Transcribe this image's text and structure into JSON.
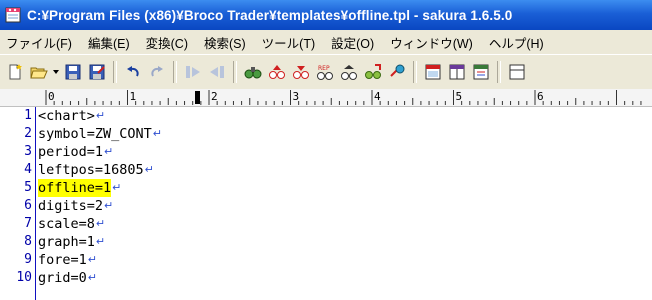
{
  "window": {
    "title": "C:¥Program Files (x86)¥Broco Trader¥templates¥offline.tpl - sakura 1.6.5.0",
    "icon": "sakura-notepad-icon"
  },
  "menu": [
    {
      "label": "ファイル(F)"
    },
    {
      "label": "編集(E)"
    },
    {
      "label": "変換(C)"
    },
    {
      "label": "検索(S)"
    },
    {
      "label": "ツール(T)"
    },
    {
      "label": "設定(O)"
    },
    {
      "label": "ウィンドウ(W)"
    },
    {
      "label": "ヘルプ(H)"
    }
  ],
  "ruler": {
    "labels": [
      "0",
      "1",
      "2",
      "3",
      "4",
      "5",
      "6"
    ]
  },
  "colors": {
    "highlight": "#ffff00",
    "line_number": "#0000a8",
    "eol_mark": "#3050d0"
  },
  "lines": [
    {
      "num": "1",
      "text": "<chart>",
      "highlight": false
    },
    {
      "num": "2",
      "text": "symbol=ZW_CONT",
      "highlight": false
    },
    {
      "num": "3",
      "text": "period=1",
      "highlight": false
    },
    {
      "num": "4",
      "text": "leftpos=16805",
      "highlight": false
    },
    {
      "num": "5",
      "text": "offline=1",
      "highlight": true
    },
    {
      "num": "6",
      "text": "digits=2",
      "highlight": false
    },
    {
      "num": "7",
      "text": "scale=8",
      "highlight": false
    },
    {
      "num": "8",
      "text": "graph=1",
      "highlight": false
    },
    {
      "num": "9",
      "text": "fore=1",
      "highlight": false
    },
    {
      "num": "10",
      "text": "grid=0",
      "highlight": false
    }
  ]
}
